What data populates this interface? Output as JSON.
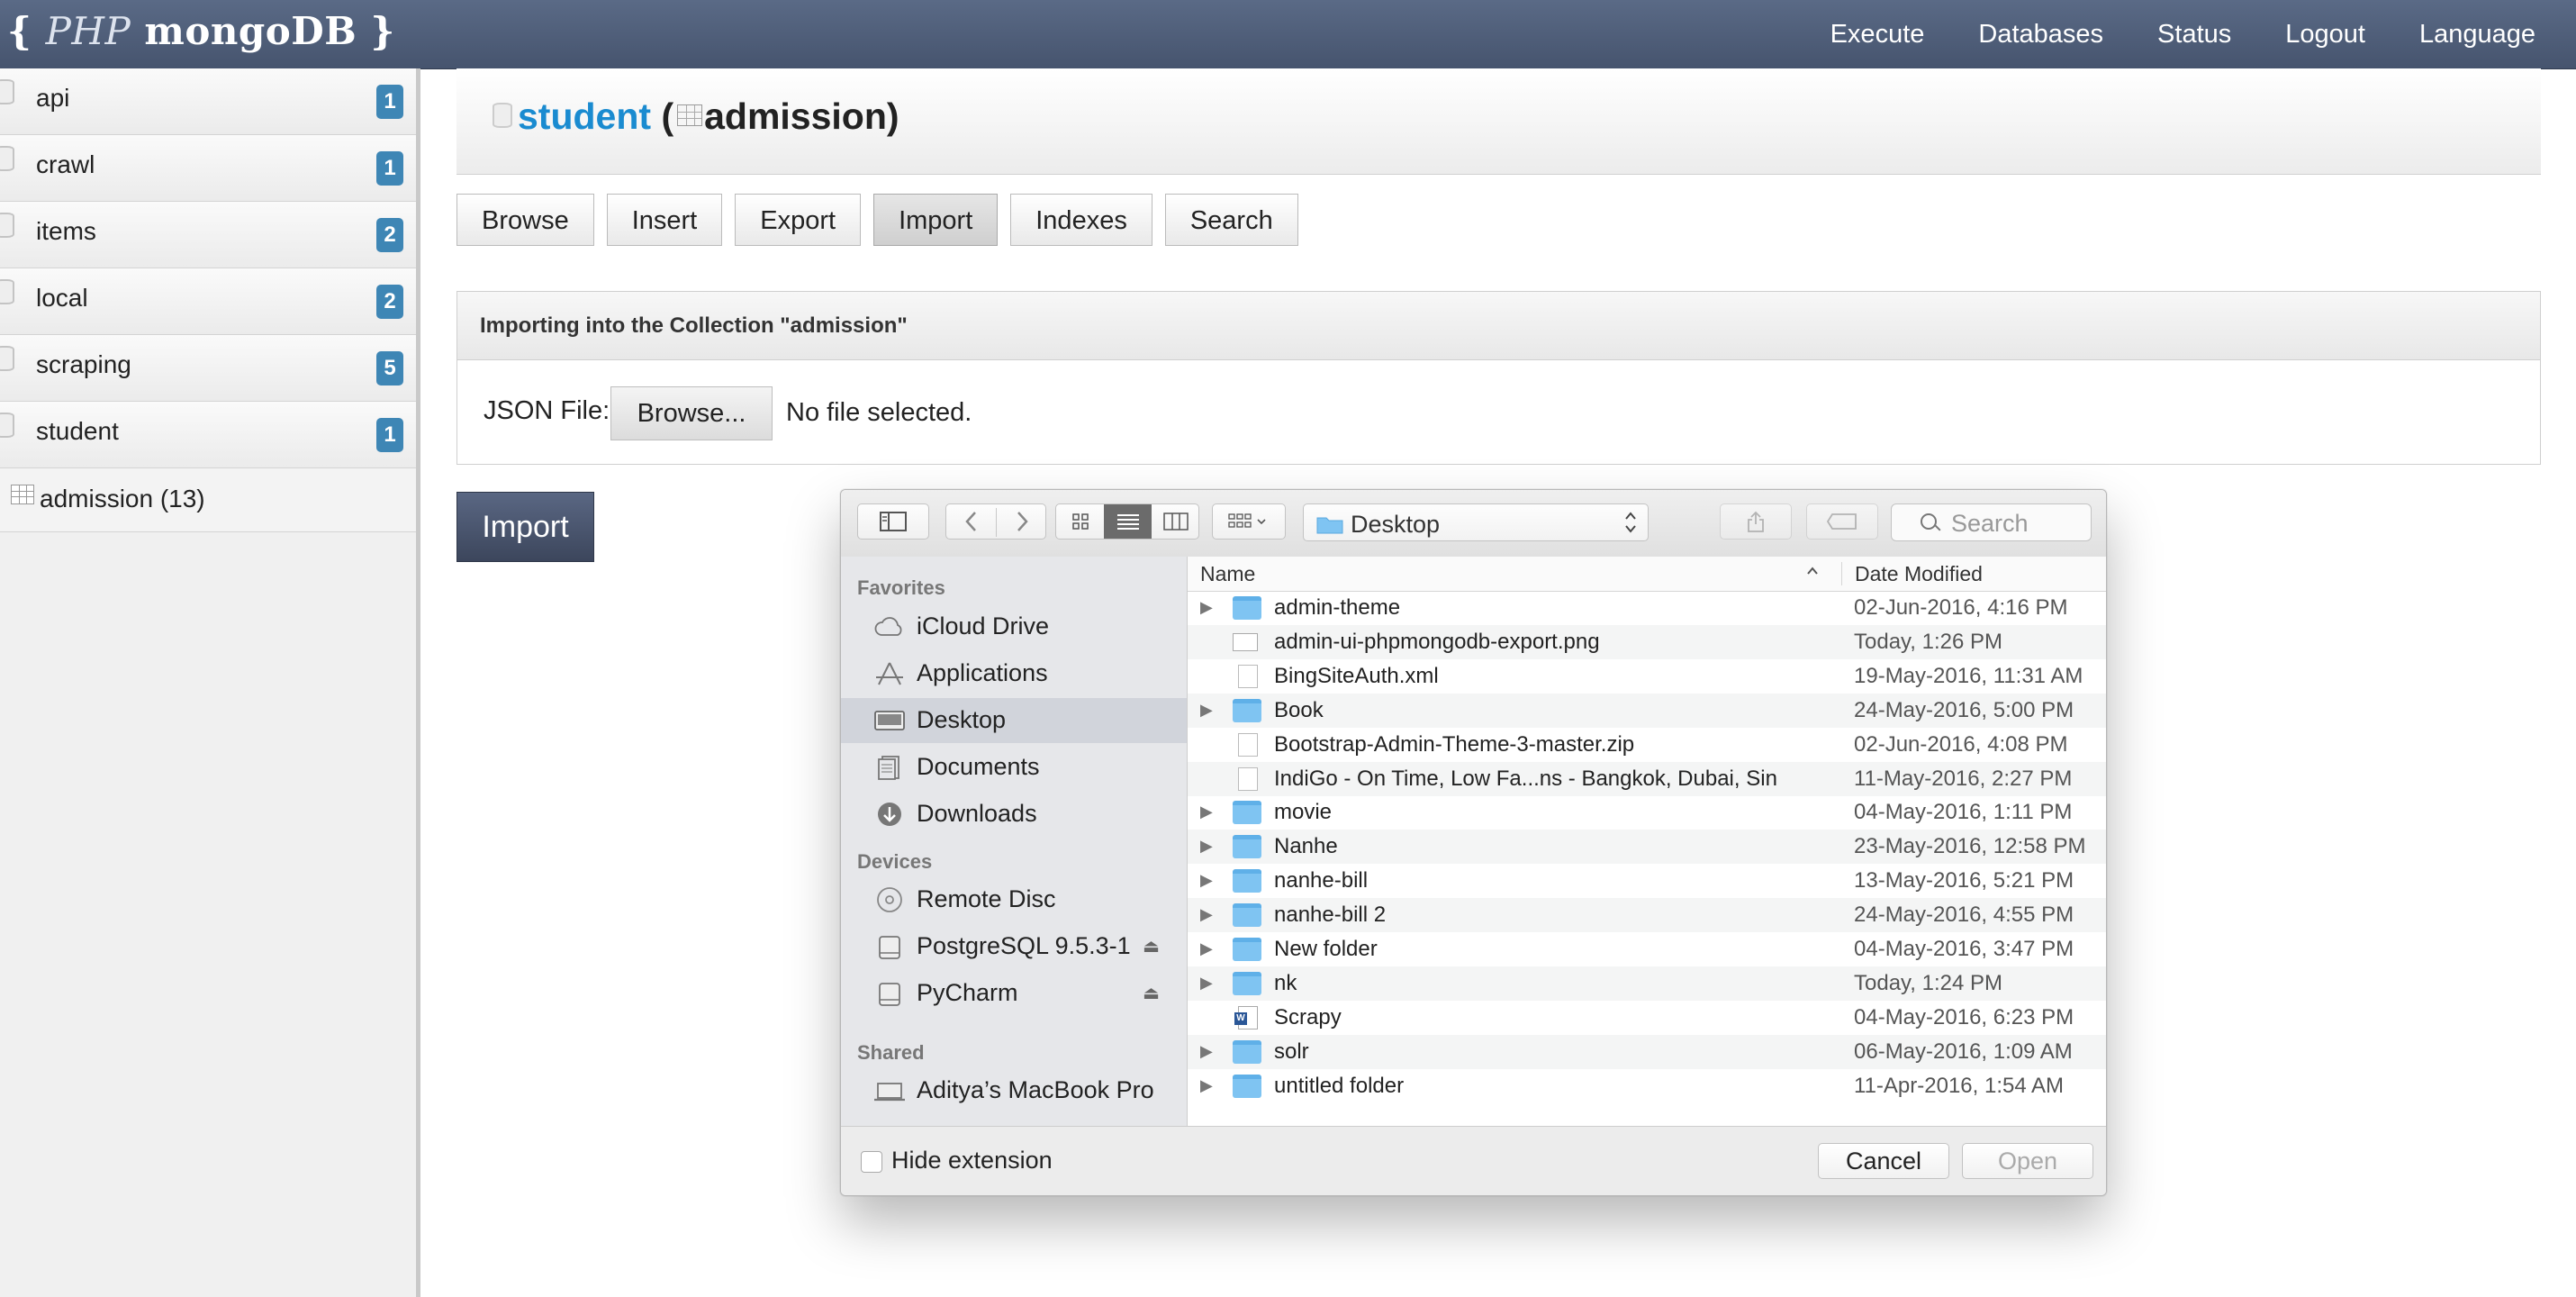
{
  "brand": {
    "open": "{",
    "php": "PHP",
    "name": "mongoDB",
    "close": "}"
  },
  "topnav": [
    "Execute",
    "Databases",
    "Status",
    "Logout",
    "Language"
  ],
  "sidebar": {
    "databases": [
      {
        "name": "api",
        "count": "1"
      },
      {
        "name": "crawl",
        "count": "1"
      },
      {
        "name": "items",
        "count": "2"
      },
      {
        "name": "local",
        "count": "2"
      },
      {
        "name": "scraping",
        "count": "5"
      },
      {
        "name": "student",
        "count": "1"
      }
    ],
    "collection": "admission (13)"
  },
  "header": {
    "db": "student",
    "open_paren": "(",
    "collection": "admission",
    "close_paren": ")"
  },
  "tabs": [
    "Browse",
    "Insert",
    "Export",
    "Import",
    "Indexes",
    "Search"
  ],
  "active_tab": "Import",
  "panel": {
    "heading": "Importing into the Collection \"admission\"",
    "json_label": "JSON File:",
    "browse_label": "Browse...",
    "no_file": "No file selected."
  },
  "import_button": "Import",
  "dialog": {
    "location": "Desktop",
    "search_placeholder": "Search",
    "sections": {
      "favorites": "Favorites",
      "devices": "Devices",
      "shared": "Shared"
    },
    "favorites": [
      "iCloud Drive",
      "Applications",
      "Desktop",
      "Documents",
      "Downloads"
    ],
    "devices": [
      "Remote Disc",
      "PostgreSQL 9.5.3-1",
      "PyCharm"
    ],
    "shared": [
      "Aditya’s MacBook Pro"
    ],
    "columns": {
      "name": "Name",
      "date": "Date Modified"
    },
    "files": [
      {
        "name": "admin-theme",
        "date": "02-Jun-2016, 4:16 PM",
        "kind": "folder"
      },
      {
        "name": "admin-ui-phpmongodb-export.png",
        "date": "Today, 1:26 PM",
        "kind": "image"
      },
      {
        "name": "BingSiteAuth.xml",
        "date": "19-May-2016, 11:31 AM",
        "kind": "file"
      },
      {
        "name": "Book",
        "date": "24-May-2016, 5:00 PM",
        "kind": "folder"
      },
      {
        "name": "Bootstrap-Admin-Theme-3-master.zip",
        "date": "02-Jun-2016, 4:08 PM",
        "kind": "file"
      },
      {
        "name": "IndiGo - On Time, Low Fa...ns - Bangkok, Dubai, Sin",
        "date": "11-May-2016, 2:27 PM",
        "kind": "file"
      },
      {
        "name": "movie",
        "date": "04-May-2016, 1:11 PM",
        "kind": "folder"
      },
      {
        "name": "Nanhe",
        "date": "23-May-2016, 12:58 PM",
        "kind": "folder"
      },
      {
        "name": "nanhe-bill",
        "date": "13-May-2016, 5:21 PM",
        "kind": "folder"
      },
      {
        "name": "nanhe-bill 2",
        "date": "24-May-2016, 4:55 PM",
        "kind": "folder"
      },
      {
        "name": "New folder",
        "date": "04-May-2016, 3:47 PM",
        "kind": "folder"
      },
      {
        "name": "nk",
        "date": "Today, 1:24 PM",
        "kind": "folder"
      },
      {
        "name": "Scrapy",
        "date": "04-May-2016, 6:23 PM",
        "kind": "doc"
      },
      {
        "name": "solr",
        "date": "06-May-2016, 1:09 AM",
        "kind": "folder"
      },
      {
        "name": "untitled folder",
        "date": "11-Apr-2016, 1:54 AM",
        "kind": "folder"
      }
    ],
    "hide_extension": "Hide extension",
    "cancel": "Cancel",
    "open": "Open"
  }
}
